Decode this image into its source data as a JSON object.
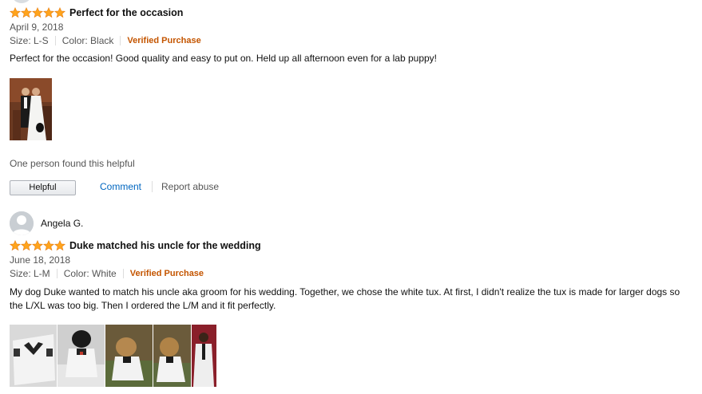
{
  "reviews": [
    {
      "rating": 5,
      "title": "Perfect for the occasion",
      "date": "April 9, 2018",
      "size": "Size: L-S",
      "color": "Color: Black",
      "verified": "Verified Purchase",
      "text": "Perfect for the occasion! Good quality and easy to put on. Held up all afternoon even for a lab puppy!",
      "helpful_text": "One person found this helpful",
      "helpful_button": "Helpful",
      "comment_link": "Comment",
      "report_link": "Report abuse"
    },
    {
      "reviewer": "Angela G.",
      "rating": 5,
      "title": "Duke matched his uncle for the wedding",
      "date": "June 18, 2018",
      "size": "Size: L-M",
      "color": "Color: White",
      "verified": "Verified Purchase",
      "text": "My dog Duke wanted to match his uncle aka groom for his wedding. Together, we chose the white tux. At first, I didn't realize the tux is made for larger dogs so the L/XL was too big. Then I ordered the L/M and it fit perfectly."
    }
  ],
  "colors": {
    "star": "#ffa41c",
    "verified": "#c45500",
    "link": "#0066c0"
  }
}
